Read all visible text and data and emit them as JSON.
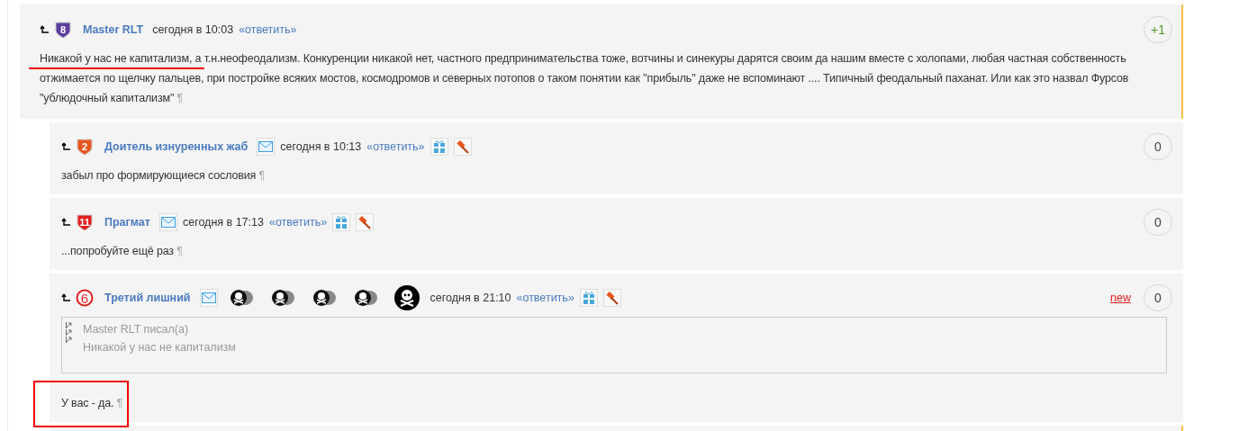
{
  "comments": [
    {
      "nested": false,
      "unread": true,
      "badge": {
        "kind": "shield",
        "number": "8",
        "color": "#5b3fa0"
      },
      "author": "Master RLT",
      "time": "сегодня в 10:03",
      "reply": "«ответить»",
      "rating": "+1",
      "rating_positive": true,
      "text": "Никакой у нас не капитализм, а т.н.неофеодализм. Конкуренции никакой нет, частного предпринимательства тоже, вотчины и синекуры дарятся своим да нашим вместе с холопами, любая частная собственность отжимается по щелчку пальцев, при постройке всяких мостов, космодромов и северных потопов о таком понятии как \"прибыль\" даже не вспоминают .... Типичный феодальный паханат. Или как это назвал Фурсов \"ублюдочный капитализм\"",
      "pilcrow": "¶",
      "underlined": true
    },
    {
      "nested": true,
      "unread": false,
      "badge": {
        "kind": "shield",
        "number": "2",
        "color": "#e8561f"
      },
      "author": "Доитель изнуренных жаб",
      "before_time": [
        {
          "kind": "mail"
        }
      ],
      "time": "сегодня в 10:13",
      "reply": "«ответить»",
      "after_reply": [
        {
          "kind": "gift"
        },
        {
          "kind": "hammer"
        }
      ],
      "rating": "0",
      "rating_positive": false,
      "text": "забыл про формирующиеся сословия",
      "pilcrow": "¶"
    },
    {
      "nested": true,
      "unread": false,
      "badge": {
        "kind": "shield",
        "number": "11",
        "color": "#e02020"
      },
      "author": "Прагмат",
      "before_time": [
        {
          "kind": "mail"
        }
      ],
      "time": "сегодня в 17:13",
      "reply": "«ответить»",
      "after_reply": [
        {
          "kind": "gift"
        },
        {
          "kind": "hammer"
        }
      ],
      "rating": "0",
      "rating_positive": false,
      "text": "...попробуйте ещё раз",
      "pilcrow": "¶"
    },
    {
      "nested": true,
      "unread": false,
      "badge": {
        "kind": "circle",
        "number": "6",
        "color": "#e02020"
      },
      "author": "Третий лишний",
      "before_time": [
        {
          "kind": "mail"
        },
        {
          "kind": "skull_small"
        },
        {
          "kind": "skull_small"
        },
        {
          "kind": "skull_small"
        },
        {
          "kind": "skull_small"
        },
        {
          "kind": "skull_big"
        }
      ],
      "time": "сегодня в 21:10",
      "reply": "«ответить»",
      "after_reply": [
        {
          "kind": "gift"
        },
        {
          "kind": "hammer"
        }
      ],
      "new_label": "new",
      "rating": "0",
      "rating_positive": false,
      "quote": [
        "Master RLT писал(а)",
        "Никакой у нас не капитализм"
      ],
      "text": "У вас - да.",
      "pilcrow": "¶",
      "framed": true
    }
  ],
  "more_cards": [
    {
      "unread": true
    }
  ]
}
